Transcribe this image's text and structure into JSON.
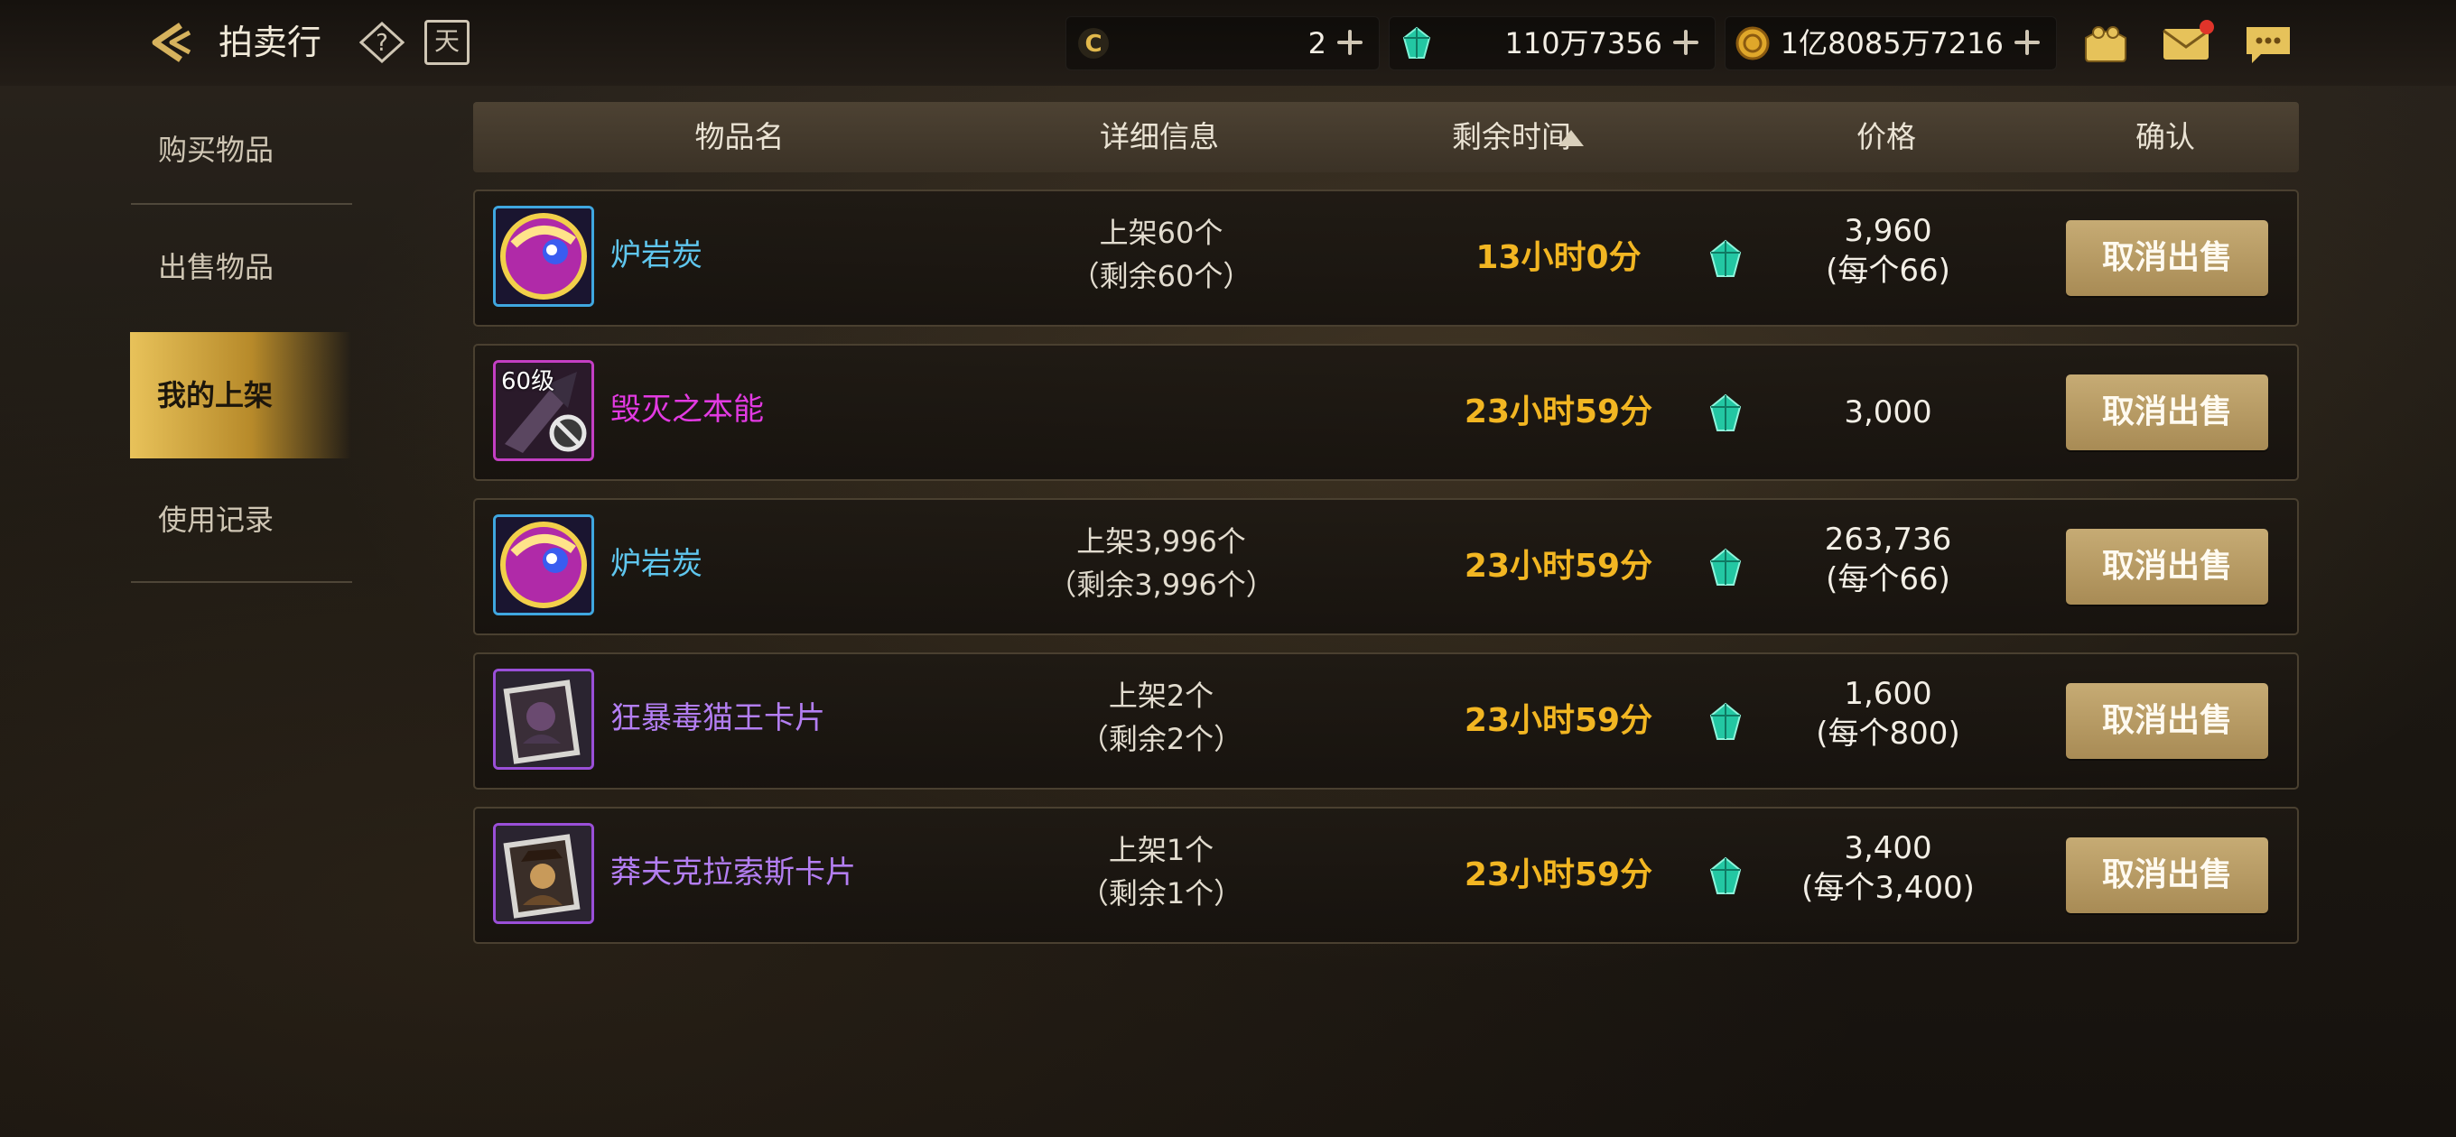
{
  "header": {
    "title": "拍卖行",
    "calendar_glyph": "天",
    "currencies": [
      {
        "icon": "coin-c-icon",
        "value": "2"
      },
      {
        "icon": "gem-icon",
        "value": "110万7356"
      },
      {
        "icon": "gold-coin-icon",
        "value": "1亿8085万7216"
      }
    ],
    "icons": [
      "wallet-icon",
      "mail-icon",
      "chat-icon"
    ]
  },
  "sidebar": {
    "items": [
      {
        "label": "购买物品",
        "active": false
      },
      {
        "label": "出售物品",
        "active": false
      },
      {
        "label": "我的上架",
        "active": true
      },
      {
        "label": "使用记录",
        "active": false
      }
    ]
  },
  "table": {
    "headers": {
      "name": "物品名",
      "detail": "详细信息",
      "time": "剩余时间",
      "price": "价格",
      "confirm": "确认"
    },
    "sort": "ascending",
    "rows": [
      {
        "name": "炉岩炭",
        "name_color": "#5fc6ee",
        "icon": "lava-rock-orb-icon",
        "frame": "blue",
        "level": "",
        "detail1": "上架60个",
        "detail2": "（剩余60个）",
        "time": "13小时0分",
        "price": "3,960",
        "unit": "(每个66)",
        "button": "取消出售"
      },
      {
        "name": "毁灭之本能",
        "name_color": "#e23ae2",
        "icon": "destruction-instinct-icon",
        "frame": "magenta",
        "level": "60级",
        "detail1": "",
        "detail2": "",
        "time": "23小时59分",
        "price": "3,000",
        "unit": "",
        "button": "取消出售"
      },
      {
        "name": "炉岩炭",
        "name_color": "#5fc6ee",
        "icon": "lava-rock-orb-icon",
        "frame": "blue",
        "level": "",
        "detail1": "上架3,996个",
        "detail2": "（剩余3,996个）",
        "time": "23小时59分",
        "price": "263,736",
        "unit": "(每个66)",
        "button": "取消出售"
      },
      {
        "name": "狂暴毒猫王卡片",
        "name_color": "#b37ef2",
        "icon": "card-icon",
        "frame": "purple",
        "level": "",
        "detail1": "上架2个",
        "detail2": "（剩余2个）",
        "time": "23小时59分",
        "price": "1,600",
        "unit": "(每个800)",
        "button": "取消出售"
      },
      {
        "name": "莽夫克拉索斯卡片",
        "name_color": "#b37ef2",
        "icon": "card-icon",
        "frame": "purple",
        "level": "",
        "detail1": "上架1个",
        "detail2": "（剩余1个）",
        "time": "23小时59分",
        "price": "3,400",
        "unit": "(每个3,400)",
        "button": "取消出售"
      }
    ]
  },
  "colors": {
    "accent_gold": "#e8c25a",
    "time_text": "#f2b622",
    "button": "#b89a62",
    "gem": "#2fd6b0"
  }
}
